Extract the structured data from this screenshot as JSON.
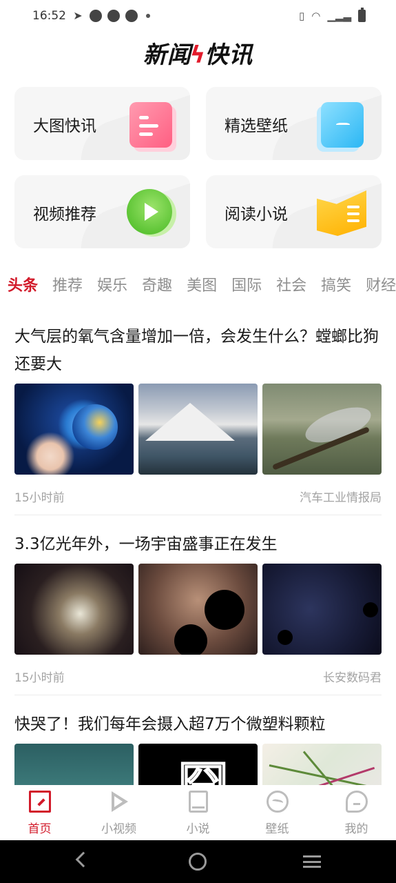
{
  "status_bar": {
    "time": "16:52"
  },
  "header": {
    "logo_left": "新闻",
    "logo_right": "快讯"
  },
  "features": [
    {
      "label": "大图快讯",
      "icon": "document-icon",
      "color": "#ff6f8f"
    },
    {
      "label": "精选壁纸",
      "icon": "phone-wallpaper-icon",
      "color": "#33bdf5"
    },
    {
      "label": "视频推荐",
      "icon": "play-icon",
      "color": "#56c22a"
    },
    {
      "label": "阅读小说",
      "icon": "book-icon",
      "color": "#ffc21a"
    }
  ],
  "tabs": [
    "头条",
    "推荐",
    "娱乐",
    "奇趣",
    "美图",
    "国际",
    "社会",
    "搞笑",
    "财经"
  ],
  "active_tab": "头条",
  "articles": [
    {
      "title": "大气层的氧气含量增加一倍，会发生什么？螳螂比狗还要大",
      "time": "15小时前",
      "source": "汽车工业情报局"
    },
    {
      "title": "3.3亿光年外，一场宇宙盛事正在发生",
      "time": "15小时前",
      "source": "长安数码君"
    },
    {
      "title": "快哭了！我们每年会摄入超7万个微塑料颗粒",
      "time": "",
      "source": ""
    }
  ],
  "bottom_nav": [
    {
      "label": "首页",
      "icon": "home-icon",
      "active": true
    },
    {
      "label": "小视频",
      "icon": "play-icon",
      "active": false
    },
    {
      "label": "小说",
      "icon": "book-icon",
      "active": false
    },
    {
      "label": "壁纸",
      "icon": "wallpaper-icon",
      "active": false
    },
    {
      "label": "我的",
      "icon": "profile-icon",
      "active": false
    }
  ],
  "colors": {
    "accent": "#d21a2a",
    "inactive": "#9a9a9a"
  }
}
